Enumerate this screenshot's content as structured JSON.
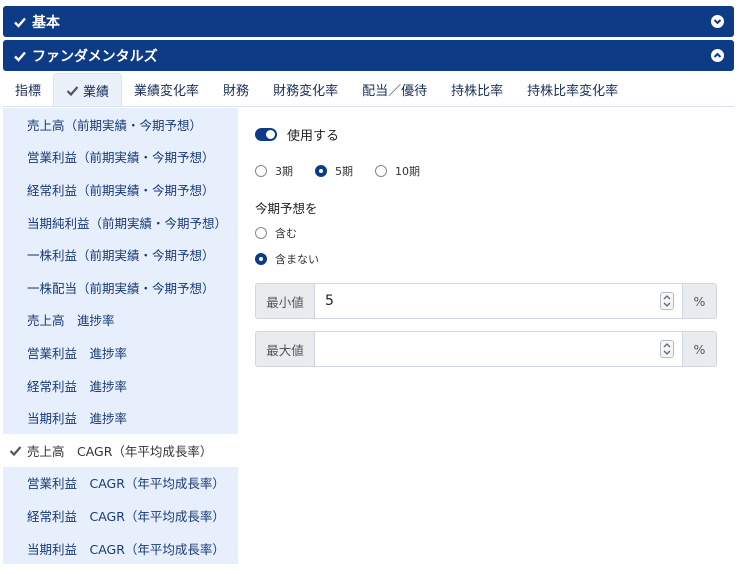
{
  "panels": {
    "basic": {
      "label": "基本"
    },
    "fundamentals": {
      "label": "ファンダメンタルズ"
    }
  },
  "tabs": [
    {
      "label": "指標"
    },
    {
      "label": "業績"
    },
    {
      "label": "業績変化率"
    },
    {
      "label": "財務"
    },
    {
      "label": "財務変化率"
    },
    {
      "label": "配当／優待"
    },
    {
      "label": "持株比率"
    },
    {
      "label": "持株比率変化率"
    }
  ],
  "active_tab": "業績",
  "list": [
    {
      "label": "売上高（前期実績・今期予想）"
    },
    {
      "label": "営業利益（前期実績・今期予想）"
    },
    {
      "label": "経常利益（前期実績・今期予想）"
    },
    {
      "label": "当期純利益（前期実績・今期予想）"
    },
    {
      "label": "一株利益（前期実績・今期予想）"
    },
    {
      "label": "一株配当（前期実績・今期予想）"
    },
    {
      "label": "売上高　進捗率"
    },
    {
      "label": "営業利益　進捗率"
    },
    {
      "label": "経常利益　進捗率"
    },
    {
      "label": "当期利益　進捗率"
    },
    {
      "label": "売上高　CAGR（年平均成長率）"
    },
    {
      "label": "営業利益　CAGR（年平均成長率）"
    },
    {
      "label": "経常利益　CAGR（年平均成長率）"
    },
    {
      "label": "当期利益　CAGR（年平均成長率）"
    }
  ],
  "active_list_item": "売上高　CAGR（年平均成長率）",
  "settings": {
    "use_label": "使用する",
    "use_enabled": true,
    "period_options": [
      "3期",
      "5期",
      "10期"
    ],
    "period_selected": "5期",
    "forecast_label": "今期予想を",
    "forecast_options": [
      "含む",
      "含まない"
    ],
    "forecast_selected": "含まない",
    "min": {
      "label": "最小値",
      "value": "5",
      "unit": "%"
    },
    "max": {
      "label": "最大値",
      "value": "",
      "unit": "%"
    }
  },
  "colors": {
    "primary": "#0d3b86",
    "list_bg": "#e6effb"
  }
}
